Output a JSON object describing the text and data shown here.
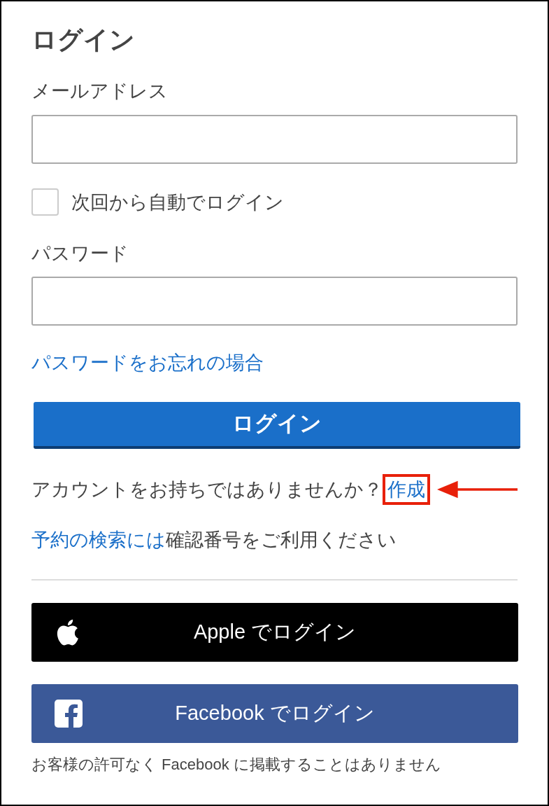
{
  "title": "ログイン",
  "email": {
    "label": "メールアドレス"
  },
  "remember": {
    "label": "次回から自動でログイン",
    "checked": false
  },
  "password": {
    "label": "パスワード"
  },
  "forgot_link": "パスワードをお忘れの場合",
  "login_button": "ログイン",
  "signup": {
    "prompt": "アカウントをお持ちではありませんか？",
    "link": "作成",
    "highlighted": true
  },
  "search_note": {
    "link": "予約の検索には",
    "text": "確認番号をご利用ください"
  },
  "social_buttons": [
    {
      "kind": "apple",
      "label": "Apple でログイン"
    },
    {
      "kind": "facebook",
      "label": "Facebook でログイン"
    }
  ],
  "footnote": "お客様の許可なく Facebook に掲載することはありません"
}
